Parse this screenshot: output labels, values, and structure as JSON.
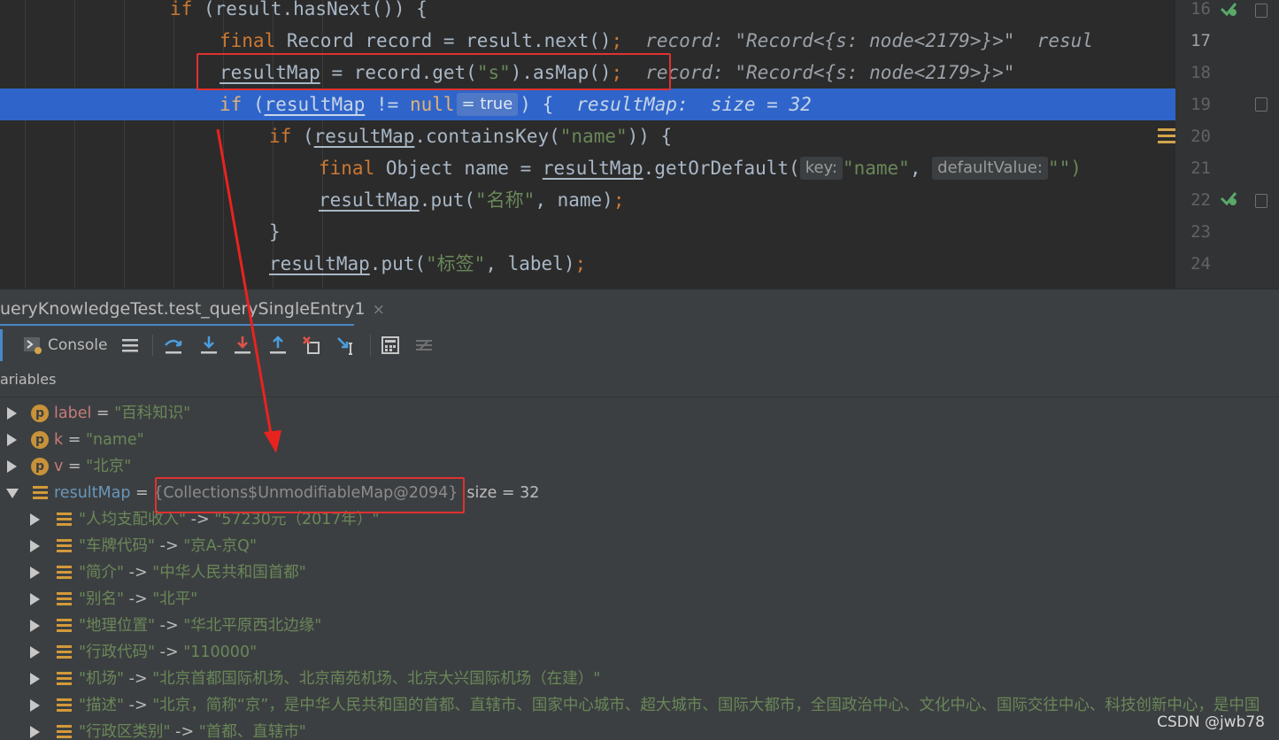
{
  "editor": {
    "lines": [
      {
        "no": "16",
        "parts": [
          [
            "if",
            "kw"
          ],
          [
            " (result.hasNext()) {",
            ""
          ]
        ]
      },
      {
        "no": "17",
        "parts": [
          [
            "final",
            "kw"
          ],
          [
            " Record record = result.next()",
            ""
          ],
          [
            ";",
            "kw"
          ]
        ],
        "hint": "record: \"Record<{s: node<2179>}>\"  resul"
      },
      {
        "no": "18",
        "parts": [
          [
            "resultMap",
            "ul"
          ],
          [
            " = record.get(",
            ""
          ],
          [
            "\"s\"",
            "str"
          ],
          [
            ").asMap()",
            ""
          ],
          [
            ";",
            "kw"
          ]
        ],
        "hint": "record: \"Record<{s: node<2179>}>\""
      },
      {
        "no": "19",
        "parts": [
          [
            "if",
            "kw exec-kw"
          ],
          [
            " (",
            ""
          ],
          [
            "resultMap",
            "ul"
          ],
          [
            " != ",
            ""
          ],
          [
            "null",
            "kw exec-kw"
          ]
        ],
        "chip": "= true",
        "after": ") {",
        "hint": "resultMap:  size = 32"
      },
      {
        "no": "20",
        "parts": [
          [
            "if",
            "kw"
          ],
          [
            " (",
            ""
          ],
          [
            "resultMap",
            "ul"
          ],
          [
            ".containsKey(",
            ""
          ],
          [
            "\"name\"",
            "str"
          ],
          [
            ")) {",
            ""
          ]
        ]
      },
      {
        "no": "21",
        "parts": [
          [
            "final",
            "kw"
          ],
          [
            " Object name = ",
            ""
          ],
          [
            "resultMap",
            "ul"
          ],
          [
            ".getOrDefault(",
            ""
          ]
        ],
        "param1": "key:",
        "arg1": "\"name\"",
        "sep": ", ",
        "param2": "defaultValue:",
        "arg2": "\"\")"
      },
      {
        "no": "22",
        "parts": [
          [
            "resultMap",
            "ul"
          ],
          [
            ".put(",
            ""
          ],
          [
            "\"名称\"",
            "str"
          ],
          [
            ", name)",
            ""
          ],
          [
            ";",
            "kw"
          ]
        ]
      },
      {
        "no": "23",
        "parts": [
          [
            "}",
            ""
          ]
        ]
      },
      {
        "no": "24",
        "parts": [
          [
            "resultMap",
            "ul"
          ],
          [
            ".put(",
            ""
          ],
          [
            "\"标签\"",
            "str"
          ],
          [
            ", label)",
            ""
          ],
          [
            ";",
            "kw"
          ]
        ]
      }
    ]
  },
  "debug": {
    "tab_label": "ueryKnowledgeTest.test_querySingleEntry1",
    "tab_close": "×",
    "console_label": "Console",
    "variables_label": "ariables",
    "variables": [
      {
        "name": "label",
        "value": "\"百科知识\""
      },
      {
        "name": "k",
        "value": "\"name\""
      },
      {
        "name": "v",
        "value": "\"北京\""
      }
    ],
    "result_map": {
      "name": "resultMap",
      "type": "{Collections$UnmodifiableMap@2094}",
      "size": "size = 32"
    },
    "entries": [
      {
        "key": "\"人均支配收入\"",
        "value": "\"57230元（2017年）\""
      },
      {
        "key": "\"车牌代码\"",
        "value": "\"京A-京Q\""
      },
      {
        "key": "\"简介\"",
        "value": "\"中华人民共和国首都\""
      },
      {
        "key": "\"别名\"",
        "value": "\"北平\""
      },
      {
        "key": "\"地理位置\"",
        "value": "\"华北平原西北边缘\""
      },
      {
        "key": "\"行政代码\"",
        "value": "\"110000\""
      },
      {
        "key": "\"机场\"",
        "value": "\"北京首都国际机场、北京南苑机场、北京大兴国际机场（在建）\""
      },
      {
        "key": "\"描述\"",
        "value": "\"北京，简称“京”，是中华人民共和国的首都、直辖市、国家中心城市、超大城市、国际大都市，全国政治中心、文化中心、国际交往中心、科技创新中心，是中国"
      },
      {
        "key": "\"行政区类别\"",
        "value": "\"首都、直辖市\""
      }
    ]
  },
  "watermark": "CSDN @jwb78",
  "colors": {
    "exec_line": "#2f65ca",
    "annotation_red": "#e03131",
    "string_green": "#6a8759",
    "keyword_orange": "#cc7832"
  }
}
